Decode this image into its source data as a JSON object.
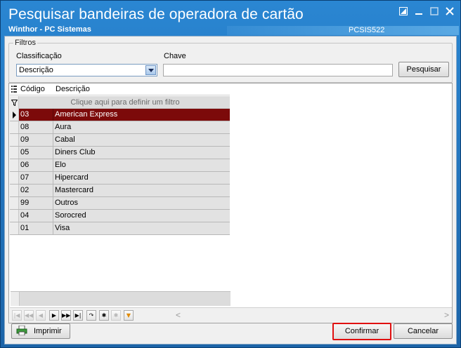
{
  "window": {
    "title": "Pesquisar bandeiras de operadora de cartão",
    "subtitle": "Winthor - PC Sistemas",
    "code": "PCSIS522"
  },
  "filters": {
    "group_label": "Filtros",
    "classificacao_label": "Classificação",
    "classificacao_value": "Descrição",
    "chave_label": "Chave",
    "chave_value": "",
    "search_button": "Pesquisar"
  },
  "grid": {
    "columns": [
      "Código",
      "Descrição"
    ],
    "filter_hint": "Clique aqui para definir um filtro",
    "rows": [
      {
        "codigo": "03",
        "descricao": "American Express"
      },
      {
        "codigo": "08",
        "descricao": "Aura"
      },
      {
        "codigo": "09",
        "descricao": "Cabal"
      },
      {
        "codigo": "05",
        "descricao": "Diners Club"
      },
      {
        "codigo": "06",
        "descricao": "Elo"
      },
      {
        "codigo": "07",
        "descricao": "Hipercard"
      },
      {
        "codigo": "02",
        "descricao": "Mastercard"
      },
      {
        "codigo": "99",
        "descricao": "Outros"
      },
      {
        "codigo": "04",
        "descricao": "Sorocred"
      },
      {
        "codigo": "01",
        "descricao": "Visa"
      }
    ],
    "selected_index": 0,
    "selected_color": "#7c0a0a"
  },
  "navigator": {
    "buttons": [
      "first-icon",
      "prev-page-icon",
      "prev-icon",
      "next-icon",
      "next-page-icon",
      "last-icon",
      "refresh-icon",
      "asterisk-icon",
      "clear-icon",
      "filter-icon"
    ]
  },
  "footer": {
    "print_button": "Imprimir",
    "confirm_button": "Confirmar",
    "cancel_button": "Cancelar",
    "highlight_color": "#e01010"
  }
}
